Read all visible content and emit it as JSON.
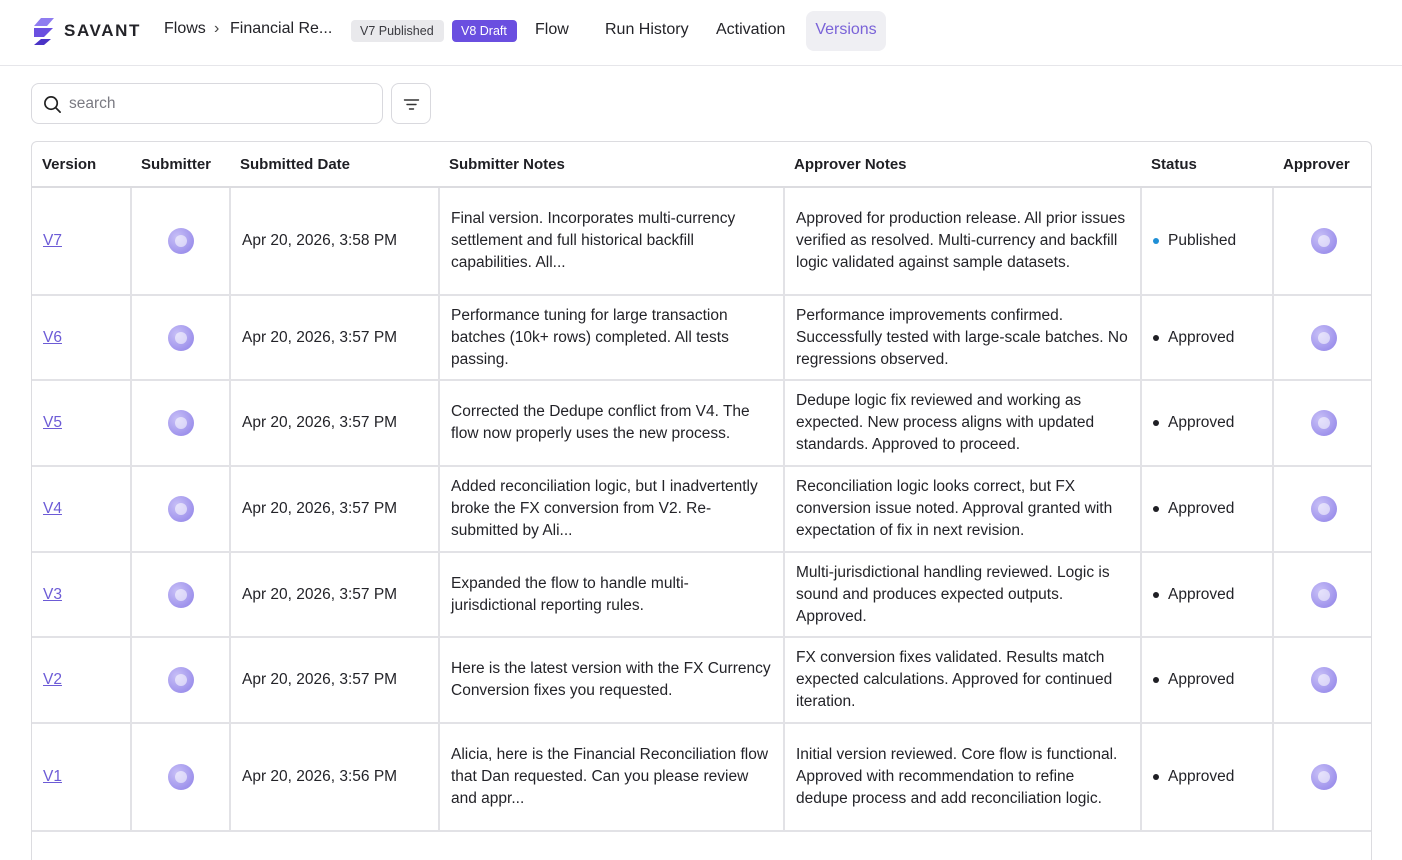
{
  "header": {
    "brand": "SAVANT",
    "breadcrumb": {
      "root": "Flows",
      "separator": "›",
      "current": "Financial Re..."
    },
    "badges": {
      "published": "V7 Published",
      "draft": "V8 Draft"
    },
    "tabs": {
      "flow": "Flow",
      "run_history": "Run History",
      "activation": "Activation",
      "versions": "Versions"
    }
  },
  "search": {
    "placeholder": "search",
    "value": ""
  },
  "table": {
    "columns": [
      "Version",
      "Submitter",
      "Submitted Date",
      "Submitter Notes",
      "Approver Notes",
      "Status",
      "Approver"
    ],
    "rows": [
      {
        "version": "V7",
        "date": "Apr 20, 2026, 3:58 PM",
        "submitter_notes": "Final version. Incorporates multi-currency settlement and full historical backfill capabilities. All...",
        "approver_notes": "Approved for production release. All prior issues verified as resolved. Multi-currency and backfill logic validated against sample datasets.",
        "status": "Published"
      },
      {
        "version": "V6",
        "date": "Apr 20, 2026, 3:57 PM",
        "submitter_notes": "Performance tuning for large transaction batches (10k+ rows) completed. All tests passing.",
        "approver_notes": "Performance improvements confirmed. Successfully tested with large-scale batches. No regressions observed.",
        "status": "Approved"
      },
      {
        "version": "V5",
        "date": "Apr 20, 2026, 3:57 PM",
        "submitter_notes": "Corrected the Dedupe conflict from V4. The flow now properly uses the new process.",
        "approver_notes": "Dedupe logic fix reviewed and working as expected. New process aligns with updated standards. Approved to proceed.",
        "status": "Approved"
      },
      {
        "version": "V4",
        "date": "Apr 20, 2026, 3:57 PM",
        "submitter_notes": "Added reconciliation logic, but I inadvertently broke the FX conversion from V2. Re-submitted by Ali...",
        "approver_notes": "Reconciliation logic looks correct, but FX conversion issue noted. Approval granted with expectation of fix in next revision.",
        "status": "Approved"
      },
      {
        "version": "V3",
        "date": "Apr 20, 2026, 3:57 PM",
        "submitter_notes": "Expanded the flow to handle multi-jurisdictional reporting rules.",
        "approver_notes": "Multi-jurisdictional handling reviewed. Logic is sound and produces expected outputs. Approved.",
        "status": "Approved"
      },
      {
        "version": "V2",
        "date": "Apr 20, 2026, 3:57 PM",
        "submitter_notes": "Here is the latest version with the FX Currency Conversion fixes you requested.",
        "approver_notes": "FX conversion fixes validated. Results match expected calculations. Approved for continued iteration.",
        "status": "Approved"
      },
      {
        "version": "V1",
        "date": "Apr 20, 2026, 3:56 PM",
        "submitter_notes": "Alicia, here is the Financial Reconciliation flow that Dan requested. Can you please review and appr...",
        "approver_notes": "Initial version reviewed. Core flow is functional. Approved with recommendation to refine dedupe process and add reconciliation logic.",
        "status": "Approved"
      }
    ]
  },
  "icons": {
    "logo": "savant-logo-icon",
    "search": "search-icon",
    "filter": "filter-icon",
    "avatar": "avatar"
  },
  "colors": {
    "accent": "#6a4fe0",
    "link": "#6c5bd6",
    "published_dot": "#1f8fd6",
    "active_tab_bg": "#efeff3",
    "active_tab_text": "#7a63d8"
  }
}
